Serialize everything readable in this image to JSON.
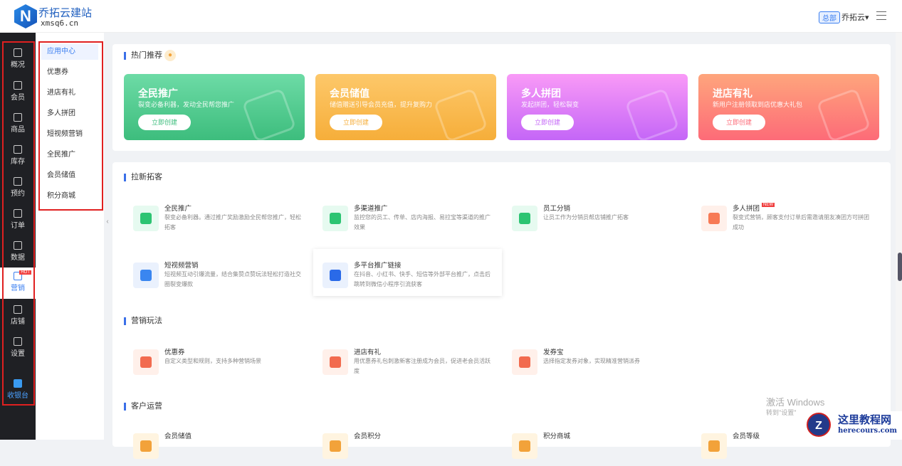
{
  "header": {
    "logo_letter": "N",
    "brand": "乔拓云建站",
    "domain": "xmsq6.cn",
    "branch_badge": "总部",
    "user": "乔拓云▾"
  },
  "sidebar": [
    {
      "label": "概况"
    },
    {
      "label": "会员"
    },
    {
      "label": "商品"
    },
    {
      "label": "库存"
    },
    {
      "label": "预约"
    },
    {
      "label": "订单"
    },
    {
      "label": "数据"
    },
    {
      "label": "营销",
      "badge": "HOT"
    },
    {
      "label": "店铺"
    },
    {
      "label": "设置"
    },
    {
      "label": "收银台"
    }
  ],
  "submenu": [
    "应用中心",
    "优惠券",
    "进店有礼",
    "多人拼团",
    "短视频营销",
    "全民推广",
    "会员储值",
    "积分商城"
  ],
  "hot": {
    "title": "热门推荐",
    "cards": [
      {
        "title": "全民推广",
        "desc": "裂变必备利器，发动全民帮您推广",
        "button": "立即创建",
        "color1": "#6ddba6",
        "color2": "#3dbd7d"
      },
      {
        "title": "会员储值",
        "desc": "储值赠送引导会员充值，提升复购力",
        "button": "立即创建",
        "color1": "#fdc86a",
        "color2": "#f6ae3a"
      },
      {
        "title": "多人拼团",
        "desc": "发起拼团，轻松裂变",
        "button": "立即创建",
        "color1": "#f99af7",
        "color2": "#c466f7"
      },
      {
        "title": "进店有礼",
        "desc": "新用户注册领取到店优惠大礼包",
        "button": "立即创建",
        "color1": "#fea57c",
        "color2": "#fd6b78"
      }
    ]
  },
  "sections": [
    {
      "title": "拉新拓客",
      "items": [
        {
          "title": "全民推广",
          "desc": "裂变必备利器。通过推广奖励激励全民帮您推广，轻松拓客",
          "bg": "#e6faf0",
          "fg": "#2cc472"
        },
        {
          "title": "多渠道推广",
          "desc": "监控您的员工、传单、店内海报、易拉宝等渠道的推广效果",
          "bg": "#e6faf0",
          "fg": "#2cc472"
        },
        {
          "title": "员工分销",
          "desc": "让员工作为分销员帮店铺推广拓客",
          "bg": "#e6faf0",
          "fg": "#2cc472"
        },
        {
          "title": "多人拼团",
          "badge": "NEW",
          "desc": "裂变式营销，顾客支付订单后需邀请朋友凑团方可拼团成功",
          "bg": "#fff0ea",
          "fg": "#f77a55"
        },
        {
          "title": "短视频营销",
          "desc": "短视频互动引爆流量，结合集赞点赞玩法轻松打造社交圈裂变爆款",
          "bg": "#eaf1fd",
          "fg": "#3a86f0"
        },
        {
          "title": "多平台推广链接",
          "desc": "在抖音、小红书、快手、短信等外部平台推广，点击后跳转到微信小程序引流获客",
          "bg": "#eaf1fd",
          "fg": "#2a6ae8"
        }
      ]
    },
    {
      "title": "营销玩法",
      "items": [
        {
          "title": "优惠券",
          "desc": "自定义类型和规则，支持多种营销场景",
          "bg": "#fff0ea",
          "fg": "#f26b4f"
        },
        {
          "title": "进店有礼",
          "desc": "用优惠券礼包刺激新客注册成为会员，促进老会员活跃度",
          "bg": "#fff0ea",
          "fg": "#f26b4f"
        },
        {
          "title": "发券宝",
          "desc": "选择指定发券对象，实现精准营销派券",
          "bg": "#fff0ea",
          "fg": "#f26b4f"
        }
      ]
    },
    {
      "title": "客户运营",
      "items": [
        {
          "title": "会员储值",
          "desc": "",
          "bg": "#fff4e0",
          "fg": "#f2a23a"
        },
        {
          "title": "会员积分",
          "desc": "",
          "bg": "#fff4e0",
          "fg": "#f2a23a"
        },
        {
          "title": "积分商城",
          "desc": "",
          "bg": "#fff4e0",
          "fg": "#f2a23a"
        },
        {
          "title": "会员等级",
          "desc": "",
          "bg": "#fff4e0",
          "fg": "#f2a23a"
        }
      ]
    }
  ],
  "overlay": {
    "win_title": "激活 Windows",
    "win_sub": "转到\"设置\"",
    "watermark_a": "这里教程网",
    "watermark_b": "herecours.com"
  }
}
